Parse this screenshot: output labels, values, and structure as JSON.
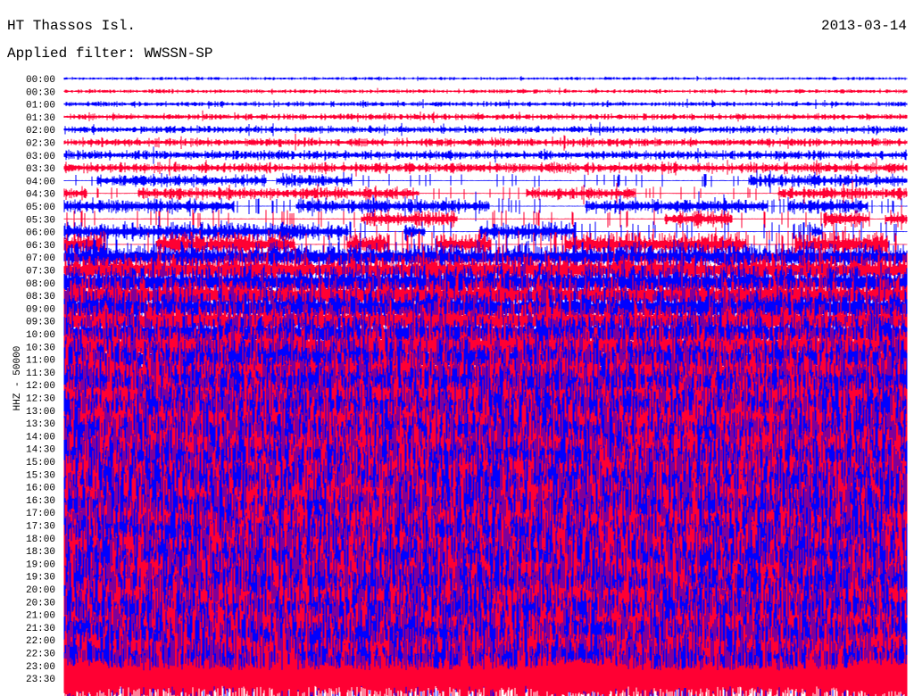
{
  "header": {
    "station": "HT Thassos Isl.",
    "date": "2013-03-14",
    "filter": "Applied filter: WWSSN-SP"
  },
  "chart_data": {
    "type": "line",
    "title": "HT Thassos Isl.",
    "ylabel": "HHZ - 50000",
    "xlabel": "",
    "row_labels": [
      "00:00",
      "00:30",
      "01:00",
      "01:30",
      "02:00",
      "02:30",
      "03:00",
      "03:30",
      "04:00",
      "04:30",
      "05:00",
      "05:30",
      "06:00",
      "06:30",
      "07:00",
      "07:30",
      "08:00",
      "08:30",
      "09:00",
      "09:30",
      "10:00",
      "10:30",
      "11:00",
      "11:30",
      "12:00",
      "12:30",
      "13:00",
      "13:30",
      "14:00",
      "14:30",
      "15:00",
      "15:30",
      "16:00",
      "16:30",
      "17:00",
      "17:30",
      "18:00",
      "18:30",
      "19:00",
      "19:30",
      "20:00",
      "20:30",
      "21:00",
      "21:30",
      "22:00",
      "22:30",
      "23:00",
      "23:30"
    ],
    "relative_amplitude": [
      0.15,
      0.2,
      0.25,
      0.3,
      0.35,
      0.4,
      0.45,
      0.5,
      0.6,
      0.6,
      0.7,
      0.8,
      0.9,
      1.2,
      1.5,
      1.6,
      1.8,
      1.9,
      2.0,
      2.0,
      2.2,
      2.4,
      2.5,
      2.7,
      3.0,
      3.2,
      3.4,
      3.6,
      3.8,
      4.0,
      4.0,
      4.2,
      4.2,
      4.3,
      4.4,
      4.4,
      4.5,
      4.5,
      4.5,
      4.5,
      4.4,
      4.3,
      4.2,
      4.0,
      4.0,
      4.0,
      4.0,
      4.0
    ],
    "sparse_rows": [
      "04:00",
      "04:30",
      "05:00",
      "05:30",
      "06:00",
      "06:30"
    ],
    "trace_colors": [
      "#0000ff",
      "#ff0033"
    ]
  }
}
